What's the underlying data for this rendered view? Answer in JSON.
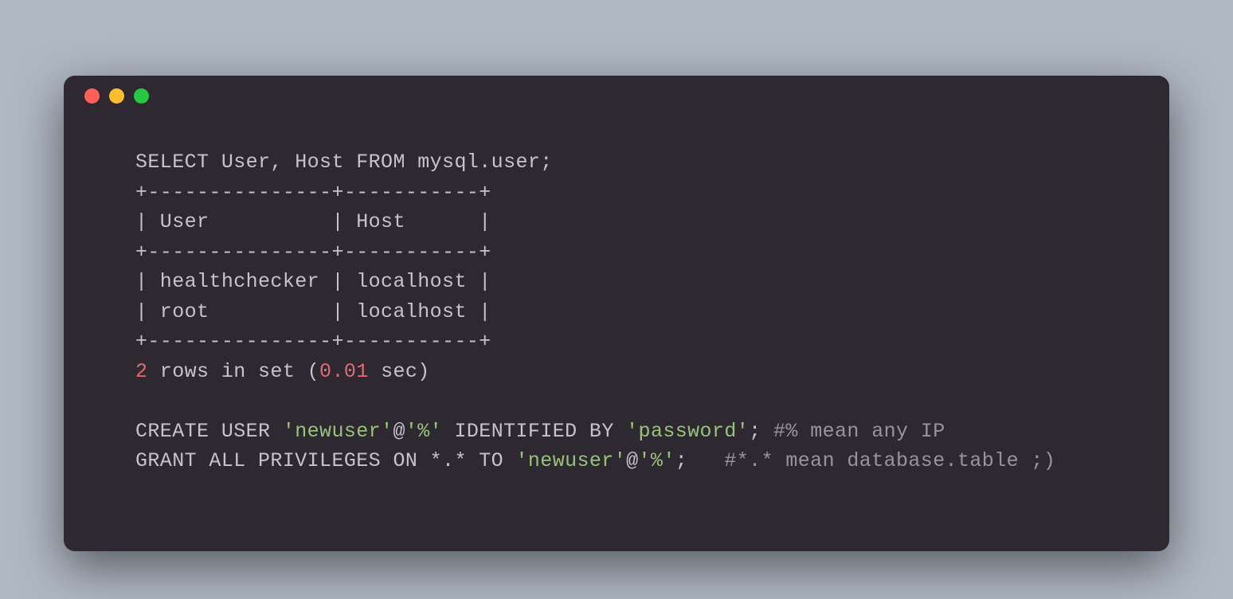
{
  "terminal": {
    "lines": [
      {
        "text": "SELECT User, Host FROM mysql.user;"
      },
      {
        "text": "+---------------+-----------+"
      },
      {
        "text": "| User          | Host      |"
      },
      {
        "text": "+---------------+-----------+"
      },
      {
        "text": "| healthchecker | localhost |"
      },
      {
        "text": "| root          | localhost |"
      },
      {
        "text": "+---------------+-----------+"
      },
      {
        "html": "<span class=\"number\">2</span> rows in set (<span class=\"number\">0.01</span> sec)"
      },
      {
        "text": ""
      },
      {
        "html": "CREATE USER <span class=\"string\">'newuser'</span>@<span class=\"string\">'%'</span> IDENTIFIED BY <span class=\"string\">'password'</span>; <span class=\"comment\">#% mean any IP</span>"
      },
      {
        "html": "GRANT ALL PRIVILEGES ON *.* TO <span class=\"string\">'newuser'</span>@<span class=\"string\">'%'</span>;   <span class=\"comment\">#*.* mean database.table ;)</span>"
      }
    ]
  }
}
